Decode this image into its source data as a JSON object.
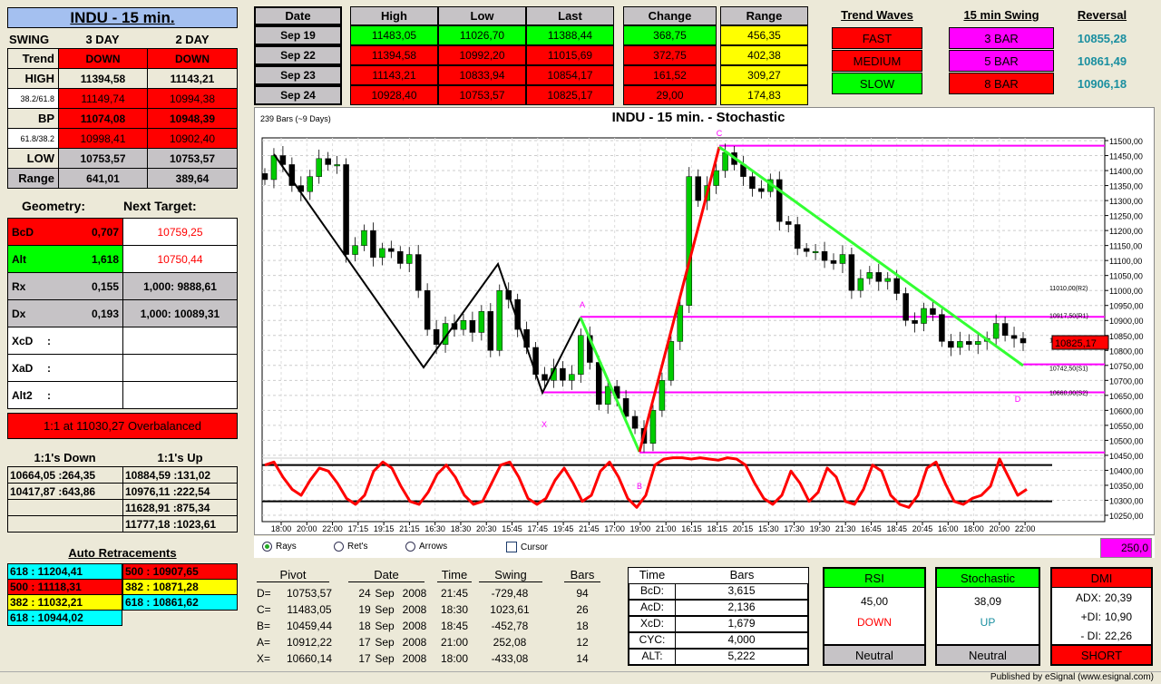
{
  "title": "INDU - 15 min.",
  "swing": {
    "label": "SWING",
    "col1": "3 DAY",
    "col2": "2 DAY",
    "rows": [
      {
        "label": "Trend",
        "v1": "DOWN",
        "v2": "DOWN"
      },
      {
        "label": "HIGH",
        "v1": "11394,58",
        "v2": "11143,21"
      },
      {
        "label": "38.2/61.8",
        "v1": "11149,74",
        "v2": "10994,38"
      },
      {
        "label": "BP",
        "v1": "11074,08",
        "v2": "10948,39"
      },
      {
        "label": "61.8/38.2",
        "v1": "10998,41",
        "v2": "10902,40"
      },
      {
        "label": "LOW",
        "v1": "10753,57",
        "v2": "10753,57"
      },
      {
        "label": "Range",
        "v1": "641,01",
        "v2": "389,64"
      }
    ]
  },
  "geometry": {
    "label": "Geometry:",
    "target_label": "Next Target:",
    "rows": [
      {
        "label": "BcD",
        "value": "0,707",
        "target": "10759,25"
      },
      {
        "label": "Alt",
        "value": "1,618",
        "target": "10750,44"
      },
      {
        "label": "Rx",
        "value": "0,155",
        "target": "1,000: 9888,61"
      },
      {
        "label": "Dx",
        "value": "0,193",
        "target": "1,000: 10089,31"
      },
      {
        "label": "XcD",
        "value": ":",
        "target": ""
      },
      {
        "label": "XaD",
        "value": ":",
        "target": ""
      },
      {
        "label": "Alt2",
        "value": ":",
        "target": ""
      }
    ],
    "overbalanced": "1:1 at 11030,27 Overbalanced"
  },
  "ones": {
    "down_label": "1:1's Down",
    "up_label": "1:1's Up",
    "down": [
      "10664,05 :264,35",
      "10417,87 :643,86",
      "",
      ""
    ],
    "up": [
      "10884,59 :131,02",
      "10976,11 :222,54",
      "11628,91 :875,34",
      "11777,18 :1023,61"
    ]
  },
  "retracements": {
    "title": "Auto Retracements",
    "left": [
      {
        "text": "618 : 11204,41",
        "color": "#00ffff"
      },
      {
        "text": "500 : 11118,31",
        "color": "#ff0000"
      },
      {
        "text": "382 : 11032,21",
        "color": "#ffff00"
      },
      {
        "text": "618 : 10944,02",
        "color": "#00ffff"
      }
    ],
    "right": [
      {
        "text": "500 : 10907,65",
        "color": "#ff0000"
      },
      {
        "text": "382 : 10871,28",
        "color": "#ffff00"
      },
      {
        "text": "618 : 10861,62",
        "color": "#00ffff"
      }
    ]
  },
  "daily": {
    "headers": {
      "date": "Date",
      "high": "High",
      "low": "Low",
      "last": "Last",
      "change": "Change",
      "range": "Range"
    },
    "rows": [
      {
        "date": "Sep  19",
        "high": "11483,05",
        "low": "11026,70",
        "last": "11388,44",
        "change": "368,75",
        "range": "456,35",
        "color": "#00ff00"
      },
      {
        "date": "Sep  22",
        "high": "11394,58",
        "low": "10992,20",
        "last": "11015,69",
        "change": "372,75",
        "range": "402,38",
        "color": "#ff0000"
      },
      {
        "date": "Sep  23",
        "high": "11143,21",
        "low": "10833,94",
        "last": "10854,17",
        "change": "161,52",
        "range": "309,27",
        "color": "#ff0000"
      },
      {
        "date": "Sep  24",
        "high": "10928,40",
        "low": "10753,57",
        "last": "10825,17",
        "change": "29,00",
        "range": "174,83",
        "color": "#ff0000"
      }
    ]
  },
  "trend_waves": {
    "title": "Trend Waves",
    "items": [
      {
        "label": "FAST",
        "color": "#ff0000"
      },
      {
        "label": "MEDIUM",
        "color": "#ff0000"
      },
      {
        "label": "SLOW",
        "color": "#00ff00"
      }
    ]
  },
  "swing15": {
    "title": "15 min Swing",
    "items": [
      {
        "label": "3 BAR",
        "color": "#ff00ff"
      },
      {
        "label": "5 BAR",
        "color": "#ff00ff"
      },
      {
        "label": "8 BAR",
        "color": "#ff0000"
      }
    ]
  },
  "reversal": {
    "title": "Reversal",
    "values": [
      "10855,28",
      "10861,49",
      "10906,18"
    ]
  },
  "chart_data": {
    "type": "candlestick",
    "title": "INDU - 15 min. - Stochastic",
    "subtitle": "239 Bars (~9 Days)",
    "ylim": [
      10250,
      11500
    ],
    "yticks": [
      "11500,00",
      "11450,00",
      "11400,00",
      "11350,00",
      "11300,00",
      "11250,00",
      "11200,00",
      "11150,00",
      "11100,00",
      "11050,00",
      "11000,00",
      "10950,00",
      "10900,00",
      "10850,00",
      "10800,00",
      "10750,00",
      "10700,00",
      "10650,00",
      "10600,00",
      "10550,00",
      "10500,00",
      "10450,00",
      "10400,00",
      "10350,00",
      "10300,00",
      "10250,00"
    ],
    "xticks": [
      "18:00",
      "20:00",
      "22:00",
      "17:15",
      "19:15",
      "21:15",
      "16:30",
      "18:30",
      "20:30",
      "15:45",
      "17:45",
      "19:45",
      "21:45",
      "17:00",
      "19:00",
      "21:00",
      "16:15",
      "18:15",
      "20:15",
      "15:30",
      "17:30",
      "19:30",
      "21:30",
      "16:45",
      "18:45",
      "20:45",
      "16:00",
      "18:00",
      "20:00",
      "22:00"
    ],
    "closes": [
      11370,
      11450,
      11420,
      11350,
      11330,
      11380,
      11440,
      11420,
      11420,
      11120,
      11150,
      11200,
      11110,
      11140,
      11130,
      11090,
      11120,
      11000,
      10870,
      10820,
      10890,
      10870,
      10900,
      10860,
      10930,
      10800,
      11000,
      10970,
      10870,
      10810,
      10720,
      10700,
      10740,
      10700,
      10720,
      10850,
      10760,
      10620,
      10680,
      10640,
      10580,
      10540,
      10490,
      10600,
      10700,
      10830,
      10950,
      11380,
      11300,
      11350,
      11400,
      11460,
      11420,
      11380,
      11340,
      11330,
      11370,
      11230,
      11220,
      11140,
      11130,
      11130,
      11100,
      11090,
      11120,
      11000,
      11040,
      11060,
      11030,
      11040,
      10990,
      10900,
      10890,
      10940,
      10920,
      10830,
      10810,
      10830,
      10820,
      10830,
      10840,
      10890,
      10850,
      10840,
      10825
    ],
    "stochastic": [
      80,
      85,
      60,
      40,
      30,
      55,
      75,
      70,
      50,
      25,
      15,
      30,
      70,
      85,
      75,
      45,
      20,
      15,
      35,
      65,
      80,
      60,
      30,
      15,
      20,
      50,
      80,
      85,
      60,
      25,
      15,
      25,
      55,
      75,
      50,
      20,
      30,
      70,
      85,
      60,
      25,
      10,
      30,
      80,
      90,
      92,
      92,
      90,
      92,
      90,
      88,
      92,
      90,
      80,
      50,
      25,
      15,
      30,
      70,
      50,
      20,
      35,
      75,
      60,
      20,
      15,
      40,
      80,
      70,
      30,
      15,
      10,
      30,
      75,
      85,
      50,
      20,
      15,
      25,
      30,
      45,
      90,
      60,
      30,
      40
    ],
    "stoch_levels": [
      80,
      20
    ],
    "swing_points": [
      {
        "label": "X",
        "price": 10660.14
      },
      {
        "label": "A",
        "price": 10912.22
      },
      {
        "label": "B",
        "price": 10459.44
      },
      {
        "label": "C",
        "price": 11483.05
      },
      {
        "label": "D",
        "price": 10753.57
      }
    ],
    "pivots": [
      {
        "label": "11010,00(R2)",
        "price": 11010
      },
      {
        "label": "10917,50(R1)",
        "price": 10917.5
      },
      {
        "label": "10835,00(P)",
        "price": 10835
      },
      {
        "label": "10742,50(S1)",
        "price": 10742.5
      },
      {
        "label": "10660,00(S2)",
        "price": 10660
      }
    ],
    "last_price": "10825,17",
    "stoch_value": "250,0"
  },
  "chart_options": {
    "rays": "Rays",
    "rets": "Ret's",
    "arrows": "Arrows",
    "cursor": "Cursor"
  },
  "pivot_table": {
    "headers": [
      "Pivot",
      "Date",
      "Time",
      "Swing",
      "Bars"
    ],
    "rows": [
      {
        "p": "D=",
        "v": "10753,57",
        "d": "24",
        "m": "Sep",
        "y": "2008",
        "t": "21:45",
        "s": "-729,48",
        "b": "94"
      },
      {
        "p": "C=",
        "v": "11483,05",
        "d": "19",
        "m": "Sep",
        "y": "2008",
        "t": "18:30",
        "s": "1023,61",
        "b": "26"
      },
      {
        "p": "B=",
        "v": "10459,44",
        "d": "18",
        "m": "Sep",
        "y": "2008",
        "t": "18:45",
        "s": "-452,78",
        "b": "18"
      },
      {
        "p": "A=",
        "v": "10912,22",
        "d": "17",
        "m": "Sep",
        "y": "2008",
        "t": "21:00",
        "s": "252,08",
        "b": "12"
      },
      {
        "p": "X=",
        "v": "10660,14",
        "d": "17",
        "m": "Sep",
        "y": "2008",
        "t": "18:00",
        "s": "-433,08",
        "b": "14"
      }
    ]
  },
  "time_bars": {
    "headers": [
      "Time",
      "Bars"
    ],
    "rows": [
      [
        "BcD:",
        "3,615"
      ],
      [
        "AcD:",
        "2,136"
      ],
      [
        "XcD:",
        "1,679"
      ],
      [
        "CYC:",
        "4,000"
      ],
      [
        "ALT:",
        "5,222"
      ]
    ]
  },
  "rsi": {
    "title": "RSI",
    "value": "45,00",
    "dir": "DOWN",
    "status": "Neutral"
  },
  "stoch": {
    "title": "Stochastic",
    "value": "38,09",
    "dir": "UP",
    "status": "Neutral"
  },
  "dmi": {
    "title": "DMI",
    "adx_label": "ADX:",
    "adx": "20,39",
    "pdi_label": "+DI:",
    "pdi": "10,90",
    "mdi_label": "- DI:",
    "mdi": "22,26",
    "status": "SHORT"
  },
  "status_bar": "Published by eSignal (www.esignal.com)"
}
